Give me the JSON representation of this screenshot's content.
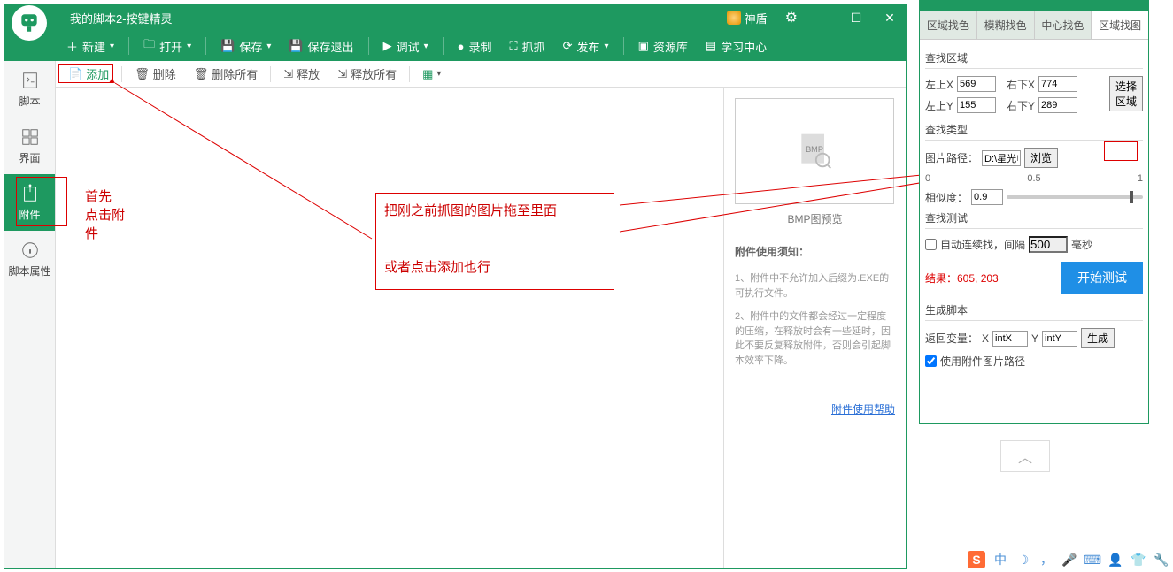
{
  "app": {
    "title": "我的脚本2-按键精灵"
  },
  "titlebar": {
    "shield": "神盾"
  },
  "menu": {
    "new": "新建",
    "open": "打开",
    "save": "保存",
    "saveExit": "保存退出",
    "debug": "调试",
    "record": "录制",
    "capture": "抓抓",
    "publish": "发布",
    "resource": "资源库",
    "learn": "学习中心"
  },
  "leftTabs": {
    "script": "脚本",
    "ui": "界面",
    "attach": "附件",
    "props": "脚本属性"
  },
  "toolbar": {
    "add": "添加",
    "delete": "删除",
    "deleteAll": "删除所有",
    "release": "释放",
    "releaseAll": "释放所有"
  },
  "rightPanel": {
    "previewLabel": "BMP图预览",
    "noticeTitle": "附件使用须知：",
    "notice1": "1、附件中不允许加入后缀为.EXE的可执行文件。",
    "notice2": "2、附件中的文件都会经过一定程度的压缩，在释放时会有一些延时，因此不要反复释放附件，否则会引起脚本效率下降。",
    "helpLink": "附件使用帮助"
  },
  "anno": {
    "first": "首先\n点击附\n件",
    "dragMsg": "把刚之前抓图的图片拖至里面",
    "orMsg": "或者点击添加也行"
  },
  "rw": {
    "tabs": [
      "区域找色",
      "模糊找色",
      "中心找色",
      "区域找图"
    ],
    "sectionArea": "查找区域",
    "tlx": "左上X",
    "tlxv": "569",
    "tly": "左上Y",
    "tlyv": "155",
    "brx": "右下X",
    "brxv": "774",
    "bry": "右下Y",
    "bryv": "289",
    "selectArea": "选择\n区域",
    "sectionType": "查找类型",
    "imgPath": "图片路径：",
    "imgPathVal": "D:\\星光电脑\\Desktop\\",
    "browse": "浏览",
    "scaleLabels": [
      "0",
      "0.5",
      "1"
    ],
    "similarity": "相似度：",
    "similarityVal": "0.9",
    "sectionTest": "查找测试",
    "autoLoop": "自动连续找，间隔",
    "autoVal": "500",
    "ms": "毫秒",
    "result": "结果：605, 203",
    "startTest": "开始测试",
    "sectionGen": "生成脚本",
    "retVar": "返回变量：",
    "xlabel": "X",
    "xval": "intX",
    "ylabel": "Y",
    "yval": "intY",
    "gen": "生成",
    "useAttach": "使用附件图片路径"
  },
  "tray": {
    "cn": "中"
  }
}
